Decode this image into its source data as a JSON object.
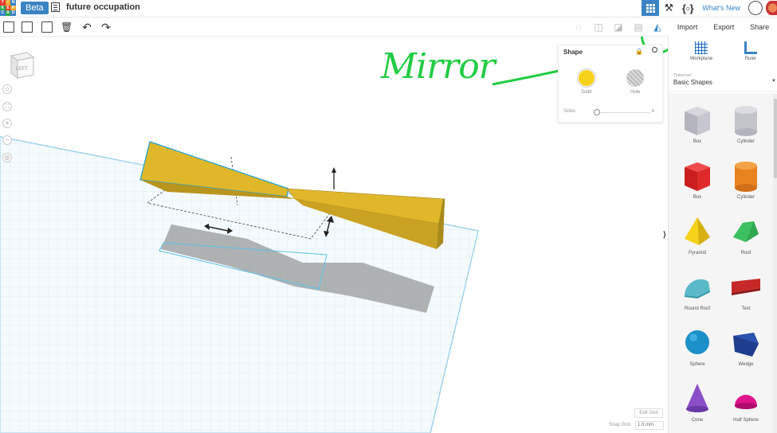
{
  "header": {
    "logo_letters": [
      "T",
      "I",
      "N",
      "K",
      "E",
      "R",
      "C",
      "A",
      "D"
    ],
    "beta_label": "Beta",
    "doc_title": "future occupation",
    "whats_new": "What's New"
  },
  "actions": {
    "import": "Import",
    "export": "Export",
    "share": "Share"
  },
  "viewcube": {
    "face": "LEFT"
  },
  "shape_panel": {
    "title": "Shape",
    "solid_label": "Solid",
    "hole_label": "Hole",
    "sides_label": "Sides",
    "sides_value": "4",
    "solid_color": "#f5d21a"
  },
  "grid_controls": {
    "edit_grid": "Edit Grid",
    "snap_grid_label": "Snap Grid",
    "snap_grid_value": "1.0 mm"
  },
  "sidebar": {
    "workplane": "Workplane",
    "ruler": "Ruler",
    "library_label": "Tinkercad",
    "category": "Basic Shapes",
    "items": [
      {
        "label": "Box"
      },
      {
        "label": "Cylinder"
      },
      {
        "label": "Box"
      },
      {
        "label": "Cylinder"
      },
      {
        "label": "Pyramid"
      },
      {
        "label": "Roof"
      },
      {
        "label": "Round Roof"
      },
      {
        "label": "Text"
      },
      {
        "label": "Sphere"
      },
      {
        "label": "Wedge"
      },
      {
        "label": "Cone"
      },
      {
        "label": "Half Sphere"
      }
    ]
  },
  "annotation": {
    "text": "Mirror",
    "color": "#22cc44"
  },
  "colors": {
    "accent": "#3b83c4",
    "shape_yellow": "#e0b72a",
    "grid_blue": "#a9d6ec"
  }
}
